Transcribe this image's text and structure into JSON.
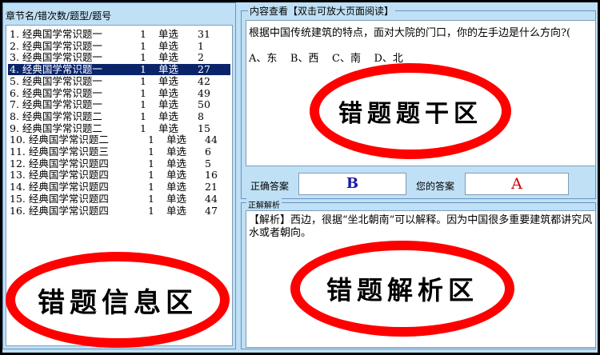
{
  "list": {
    "header": "章节名/错次数/题型/题号",
    "items": [
      {
        "name": "1. 经典国学常识题一",
        "count": "1",
        "type": "单选",
        "num": "31"
      },
      {
        "name": "2. 经典国学常识题一",
        "count": "1",
        "type": "单选",
        "num": "1"
      },
      {
        "name": "3. 经典国学常识题一",
        "count": "1",
        "type": "单选",
        "num": "2"
      },
      {
        "name": "4. 经典国学常识题一",
        "count": "1",
        "type": "单选",
        "num": "27"
      },
      {
        "name": "5. 经典国学常识题一",
        "count": "1",
        "type": "单选",
        "num": "42"
      },
      {
        "name": "6. 经典国学常识题一",
        "count": "1",
        "type": "单选",
        "num": "49"
      },
      {
        "name": "7. 经典国学常识题一",
        "count": "1",
        "type": "单选",
        "num": "50"
      },
      {
        "name": "8. 经典国学常识题二",
        "count": "1",
        "type": "单选",
        "num": "8"
      },
      {
        "name": "9. 经典国学常识题二",
        "count": "1",
        "type": "单选",
        "num": "15"
      },
      {
        "name": "10. 经典国学常识题二",
        "count": "1",
        "type": "单选",
        "num": "44"
      },
      {
        "name": "11. 经典国学常识题三",
        "count": "1",
        "type": "单选",
        "num": "6"
      },
      {
        "name": "12. 经典国学常识题四",
        "count": "1",
        "type": "单选",
        "num": "5"
      },
      {
        "name": "13. 经典国学常识题四",
        "count": "1",
        "type": "单选",
        "num": "16"
      },
      {
        "name": "14. 经典国学常识题四",
        "count": "1",
        "type": "单选",
        "num": "21"
      },
      {
        "name": "15. 经典国学常识题四",
        "count": "1",
        "type": "单选",
        "num": "44"
      },
      {
        "name": "16. 经典国学常识题四",
        "count": "1",
        "type": "单选",
        "num": "47"
      }
    ],
    "selected_index": 3
  },
  "content": {
    "legend": "内容查看【双击可放大页面阅读】",
    "question": "根据中国传统建筑的特点，面对大院的门口，你的左手边是什么方向?(",
    "options": "A、东    B、西    C、南    D、北"
  },
  "answers": {
    "correct_label": "正确答案",
    "correct_value": "B",
    "yours_label": "您的答案",
    "yours_value": "A",
    "correct_color": "#1a1aa6",
    "yours_color": "#cc0000"
  },
  "analysis": {
    "legend": "正解解析",
    "text": "【解析】西边，很据“坐北朝南”可以解释。因为中国很多重要建筑都讲究风水或者朝向。"
  },
  "annotations": {
    "list_area": "错题信息区",
    "question_area": "错题题干区",
    "analysis_area": "错题解析区",
    "ring_color": "#ff0000"
  }
}
